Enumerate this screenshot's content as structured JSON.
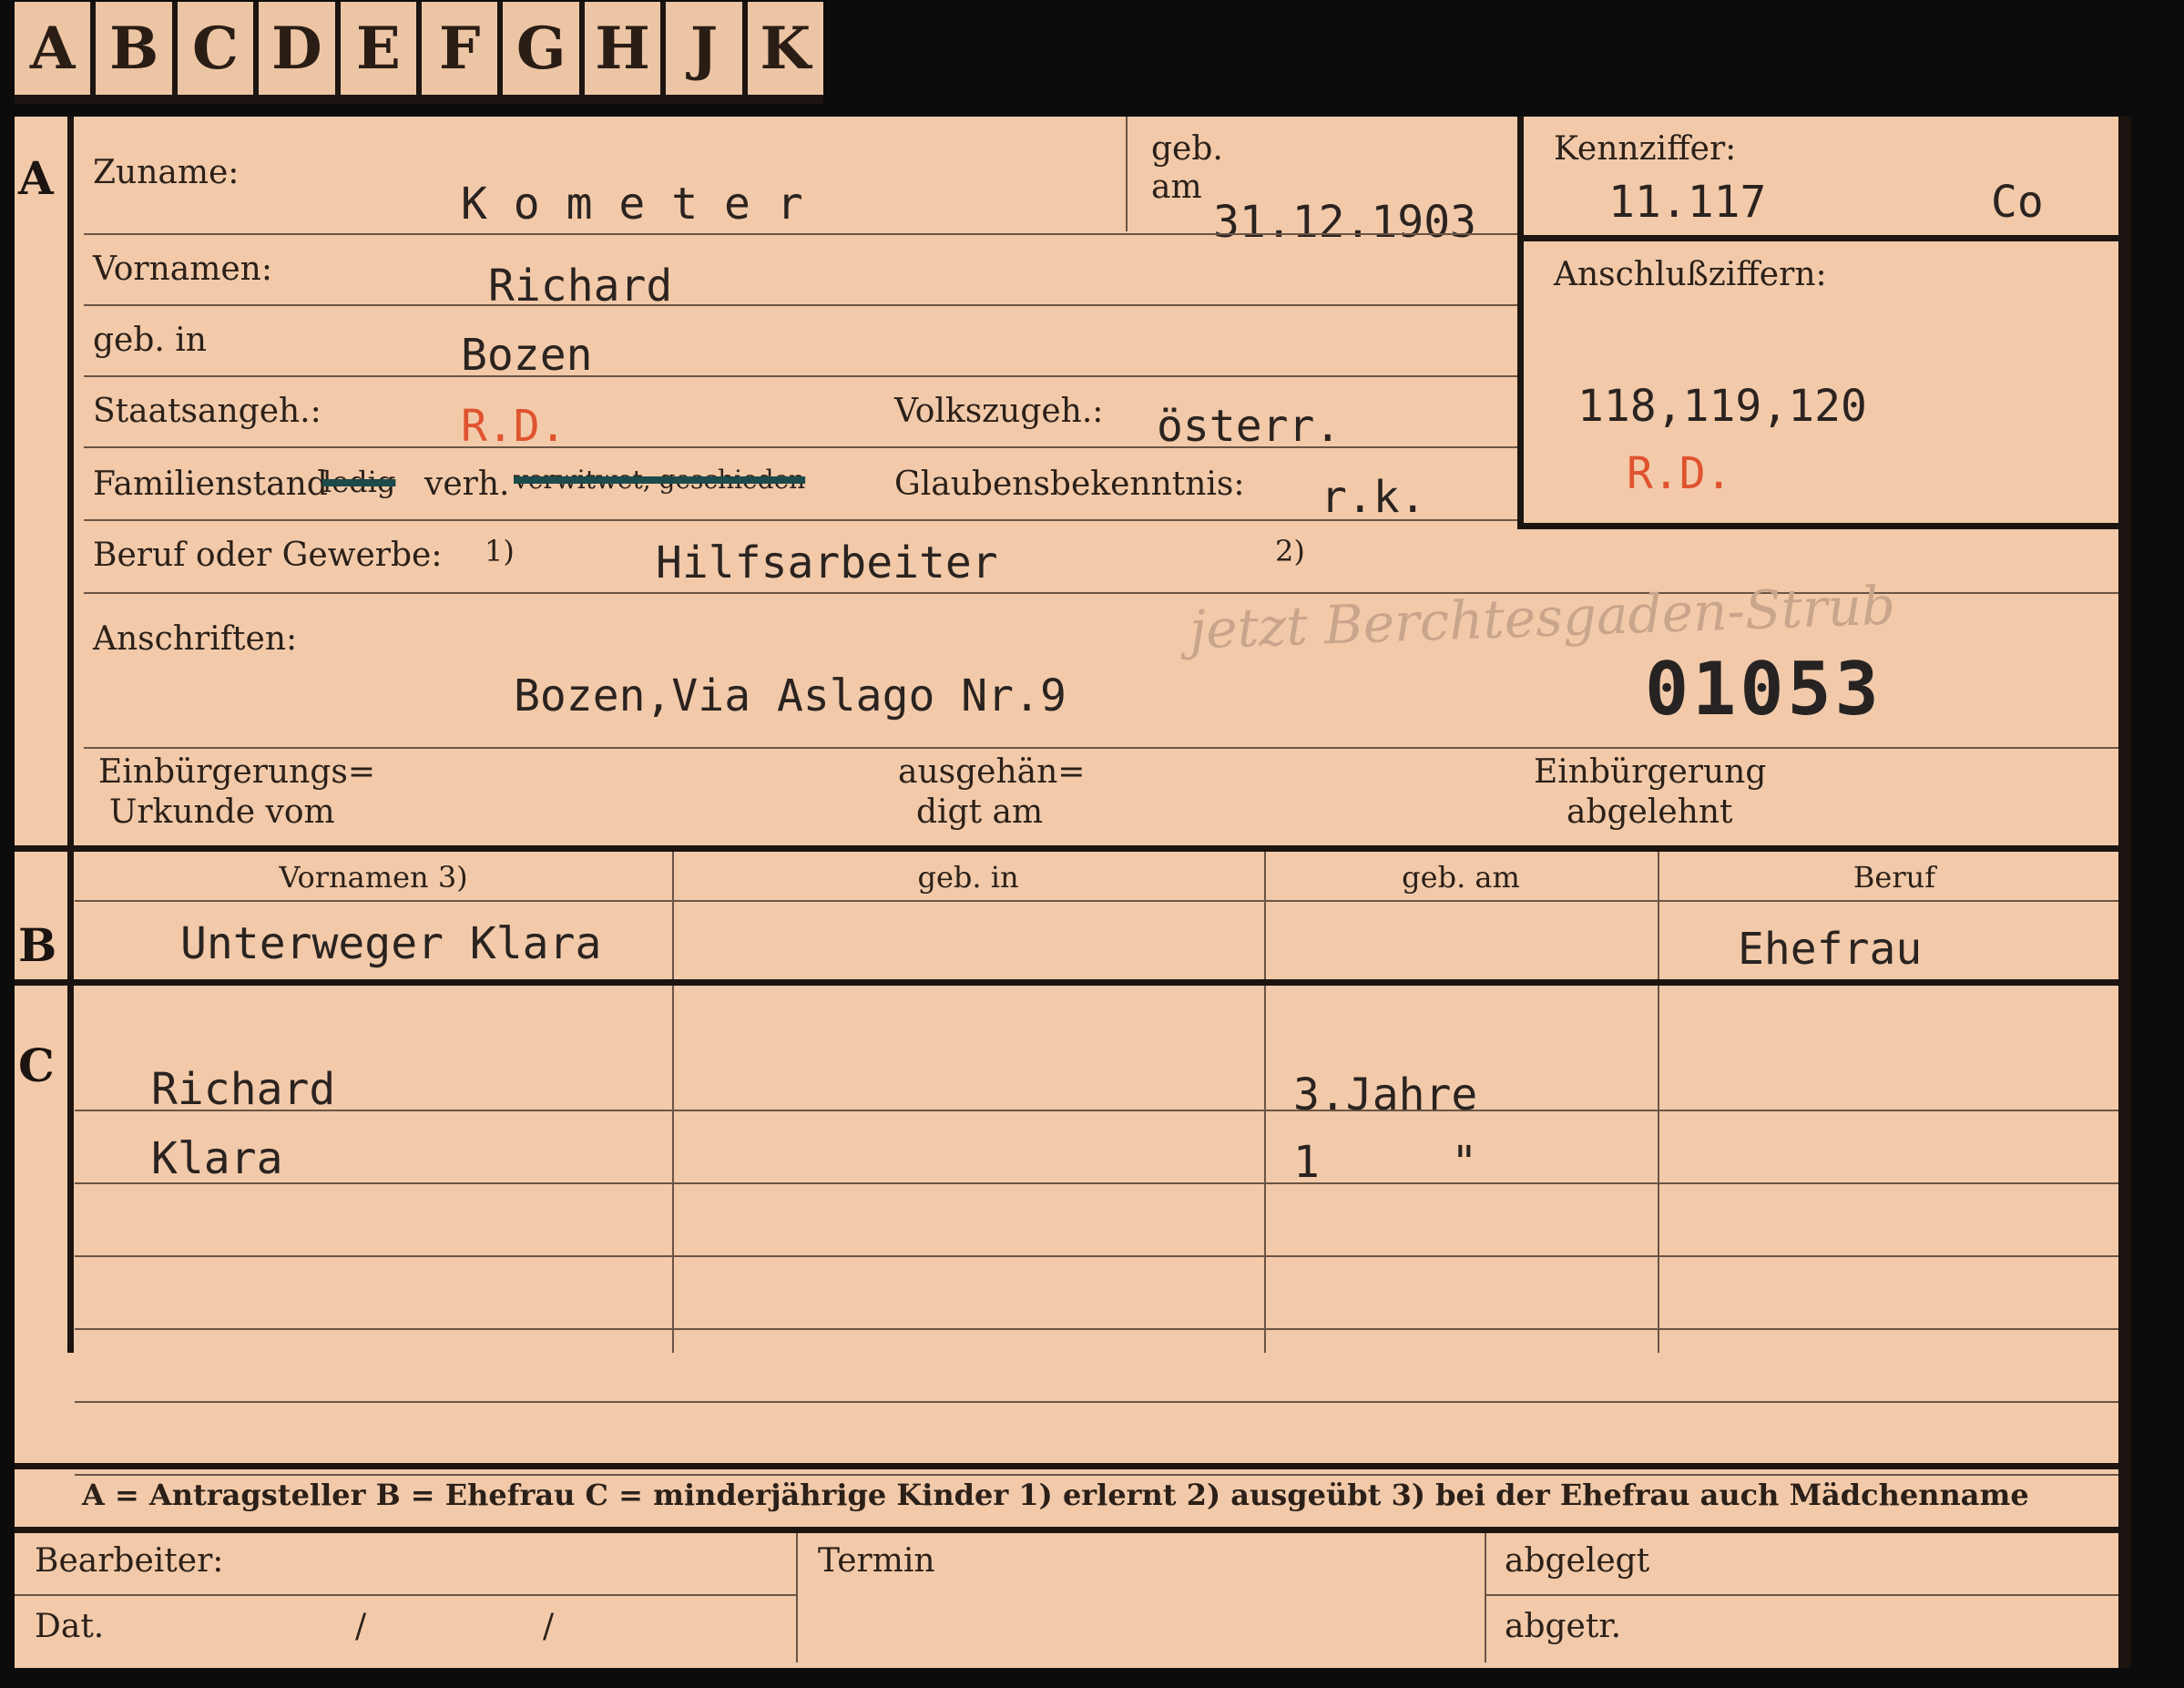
{
  "index_tabs": [
    "A",
    "B",
    "C",
    "D",
    "E",
    "F",
    "G",
    "H",
    "J",
    "K"
  ],
  "section_a": {
    "marker": "A",
    "zuname_label": "Zuname:",
    "zuname_value": "K o m e t e r",
    "geb_am_label_1": "geb.",
    "geb_am_label_2": "am",
    "geb_am_value": "31.12.1903",
    "vornamen_label": "Vornamen:",
    "vornamen_value": "Richard",
    "geb_in_label": "geb. in",
    "geb_in_value": "Bozen",
    "staatsangeh_label": "Staatsangeh.:",
    "staatsangeh_value": "R.D.",
    "volkszugeh_label": "Volkszugeh.:",
    "volkszugeh_value": "österr.",
    "familienstand_label": "Familienstand",
    "familienstand_struck_1": "ledig",
    "familienstand_value": "verh.",
    "familienstand_struck_2": "verwitwet, geschieden",
    "glauben_label": "Glaubensbekenntnis:",
    "glauben_value": "r.k.",
    "beruf_label": "Beruf oder Gewerbe:",
    "beruf_note_1": "1)",
    "beruf_value": "Hilfsarbeiter",
    "beruf_note_2": "2)",
    "anschriften_label": "Anschriften:",
    "anschriften_value": "Bozen,Via Aslago Nr.9",
    "handwritten_note": "jetzt Berchtesgaden-Strub",
    "stamp_number": "01053",
    "einbuergerung_label_1": "Einbürgerungs=",
    "einbuergerung_label_2": "Urkunde vom",
    "ausgehaendigt_label_1": "ausgehän=",
    "ausgehaendigt_label_2": "digt am",
    "abgelehnt_label_1": "Einbürgerung",
    "abgelehnt_label_2": "abgelehnt"
  },
  "kennziffer": {
    "label": "Kennziffer:",
    "value": "11.117",
    "code": "Co",
    "anschluss_label": "Anschlußziffern:",
    "anschluss_value": "118,119,120",
    "anschluss_stamp": "R.D."
  },
  "section_b": {
    "marker": "B",
    "headers": [
      "Vornamen 3)",
      "geb. in",
      "geb. am",
      "Beruf"
    ],
    "row": [
      "Unterweger Klara",
      "",
      "",
      "Ehefrau"
    ]
  },
  "section_c": {
    "marker": "C",
    "rows": [
      [
        "Richard",
        "",
        "3.Jahre",
        ""
      ],
      [
        "Klara",
        "",
        "1     \"",
        ""
      ]
    ]
  },
  "legend": "A = Antragsteller   B = Ehefrau   C = minderjährige Kinder   1) erlernt   2) ausgeübt   3) bei der Ehefrau auch Mädchenname",
  "footer": {
    "bearbeiter_label": "Bearbeiter:",
    "dat_label": "Dat.",
    "slash_1": "/",
    "slash_2": "/",
    "termin_label": "Termin",
    "abgelegt_label": "abgelegt",
    "abgetr_label": "abgetr."
  }
}
